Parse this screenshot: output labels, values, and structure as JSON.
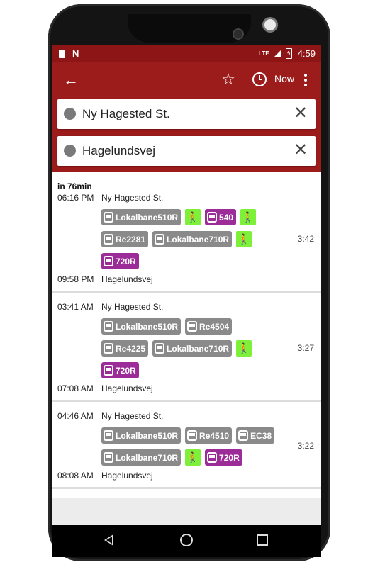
{
  "status_bar": {
    "time": "4:59",
    "network": "LTE"
  },
  "app_bar": {
    "now_label": "Now"
  },
  "search": {
    "from": "Ny Hagested St.",
    "to": "Hagelundsvej"
  },
  "trips": [
    {
      "header": "in 76min",
      "depart_time": "06:16 PM",
      "depart_place": "Ny Hagested St.",
      "arrive_time": "09:58 PM",
      "arrive_place": "Hagelundsvej",
      "duration": "3:42",
      "legs": [
        [
          {
            "type": "bus",
            "label": "Lokalbane510R",
            "color": "gray"
          },
          {
            "type": "walk"
          },
          {
            "type": "bus",
            "label": "540",
            "color": "purple"
          },
          {
            "type": "walk"
          }
        ],
        [
          {
            "type": "bus",
            "label": "Re2281",
            "color": "gray"
          },
          {
            "type": "bus",
            "label": "Lokalbane710R",
            "color": "gray"
          },
          {
            "type": "walk"
          }
        ],
        [
          {
            "type": "bus",
            "label": "720R",
            "color": "purple"
          }
        ]
      ]
    },
    {
      "header": "",
      "depart_time": "03:41 AM",
      "depart_place": "Ny Hagested St.",
      "arrive_time": "07:08 AM",
      "arrive_place": "Hagelundsvej",
      "duration": "3:27",
      "legs": [
        [
          {
            "type": "bus",
            "label": "Lokalbane510R",
            "color": "gray"
          },
          {
            "type": "bus",
            "label": "Re4504",
            "color": "gray"
          }
        ],
        [
          {
            "type": "bus",
            "label": "Re4225",
            "color": "gray"
          },
          {
            "type": "bus",
            "label": "Lokalbane710R",
            "color": "gray"
          },
          {
            "type": "walk"
          }
        ],
        [
          {
            "type": "bus",
            "label": "720R",
            "color": "purple"
          }
        ]
      ]
    },
    {
      "header": "",
      "depart_time": "04:46 AM",
      "depart_place": "Ny Hagested St.",
      "arrive_time": "08:08 AM",
      "arrive_place": "Hagelundsvej",
      "duration": "3:22",
      "legs": [
        [
          {
            "type": "bus",
            "label": "Lokalbane510R",
            "color": "gray"
          },
          {
            "type": "bus",
            "label": "Re4510",
            "color": "gray"
          },
          {
            "type": "bus",
            "label": "EC38",
            "color": "gray"
          }
        ],
        [
          {
            "type": "bus",
            "label": "Lokalbane710R",
            "color": "gray"
          },
          {
            "type": "walk"
          },
          {
            "type": "bus",
            "label": "720R",
            "color": "purple"
          }
        ]
      ]
    }
  ],
  "colors": {
    "status_bar": "#8e1515",
    "app_bar": "#9c1b1b",
    "walk": "#7ef03a",
    "purple": "#9c2c98",
    "gray": "#8a8a8a"
  }
}
